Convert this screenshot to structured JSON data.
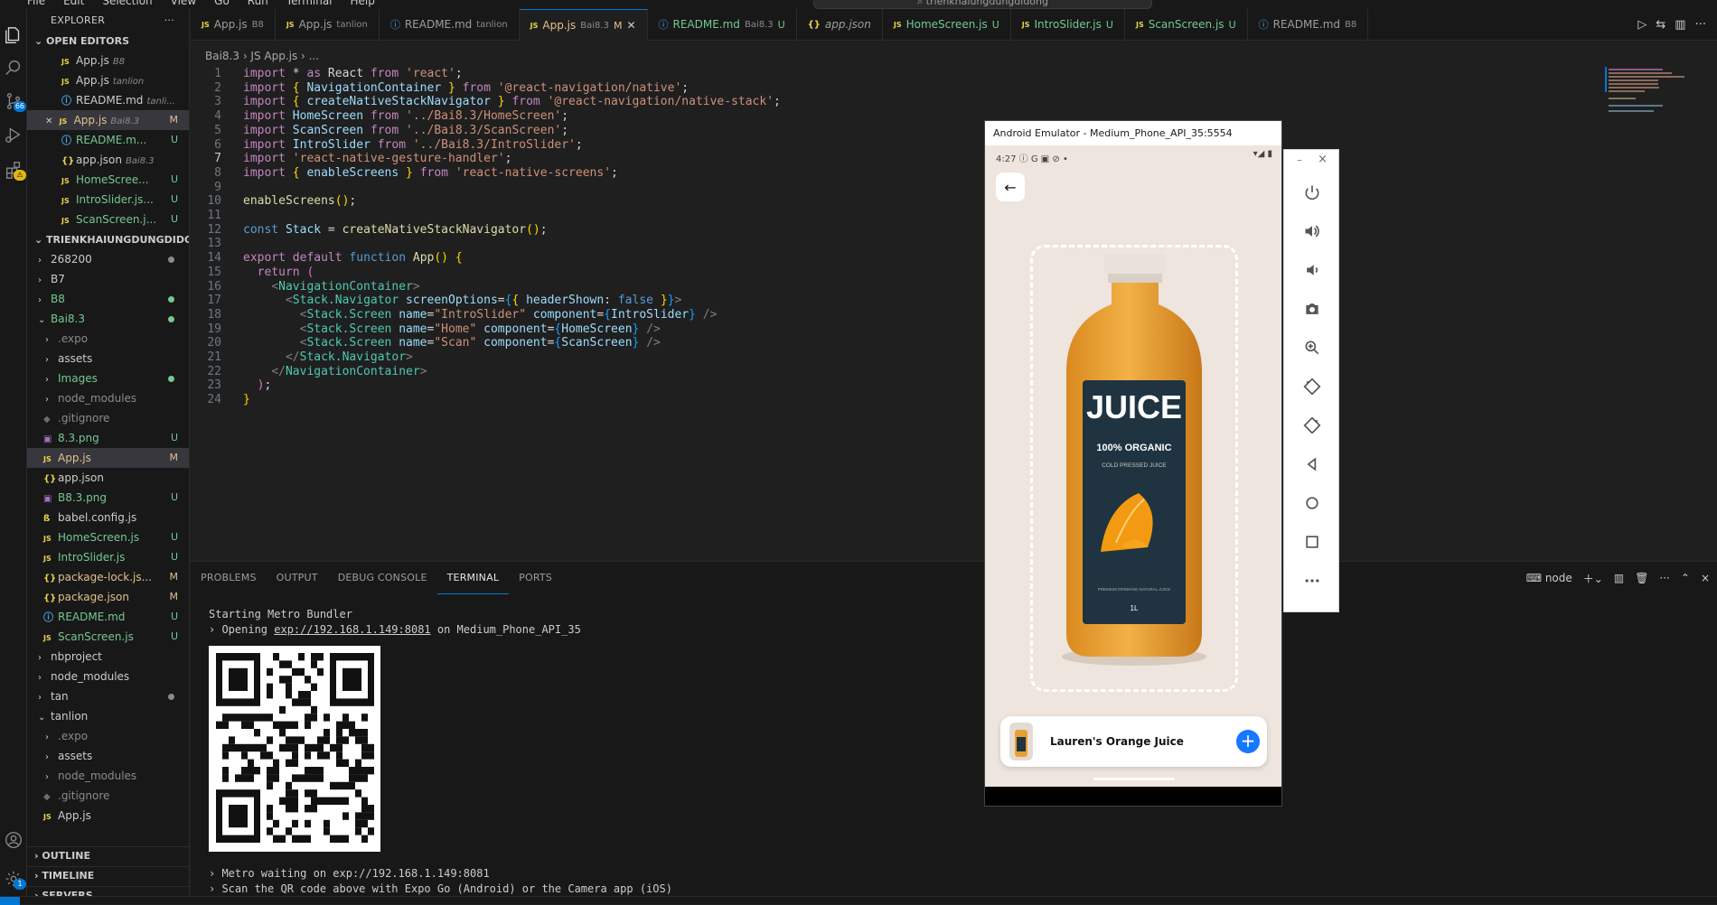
{
  "titlebar": {
    "menu": [
      "File",
      "Edit",
      "Selection",
      "View",
      "Go",
      "Run",
      "Terminal",
      "Help"
    ],
    "search": "trienkhaiungdungdidong"
  },
  "activity": {
    "scm_badge": "66",
    "extensions_badge": "1"
  },
  "explorer": {
    "title": "EXPLORER",
    "more": "···",
    "open_editors_header": "OPEN EDITORS",
    "open_editors": [
      {
        "icon": "JS",
        "name": "App.js",
        "desc": "B8",
        "status": ""
      },
      {
        "icon": "JS",
        "name": "App.js",
        "desc": "tanlion",
        "status": ""
      },
      {
        "icon": "ⓘ",
        "name": "README.md",
        "desc": "tanli...",
        "status": ""
      },
      {
        "icon": "JS",
        "name": "App.js",
        "desc": "Bai8.3",
        "status": "M"
      },
      {
        "icon": "ⓘ",
        "name": "README.m...",
        "desc": "",
        "status": "U"
      },
      {
        "icon": "{}",
        "name": "app.json",
        "desc": "Bai8.3",
        "status": ""
      },
      {
        "icon": "JS",
        "name": "HomeScree...",
        "desc": "",
        "status": "U"
      },
      {
        "icon": "JS",
        "name": "IntroSlider.js...",
        "desc": "",
        "status": "U"
      },
      {
        "icon": "JS",
        "name": "ScanScreen.j...",
        "desc": "",
        "status": "U"
      }
    ],
    "workspace_header": "TRIENKHAIUNGDUNGDIDO...",
    "tree": [
      {
        "chev": "›",
        "name": "268200",
        "indent": 0
      },
      {
        "chev": "›",
        "name": "B7",
        "indent": 0
      },
      {
        "chev": "›",
        "name": "B8",
        "indent": 0
      },
      {
        "chev": "⌄",
        "name": "Bai8.3",
        "indent": 0
      },
      {
        "chev": "›",
        "name": ".expo",
        "indent": 1
      },
      {
        "chev": "›",
        "name": "assets",
        "indent": 1
      },
      {
        "chev": "›",
        "name": "Images",
        "indent": 1
      },
      {
        "chev": "›",
        "name": "node_modules",
        "indent": 1
      },
      {
        "icon": "◆",
        "name": ".gitignore",
        "indent": 1
      },
      {
        "icon": "▣",
        "name": "8.3.png",
        "indent": 1,
        "status": "U"
      },
      {
        "icon": "JS",
        "name": "App.js",
        "indent": 1,
        "status": "M"
      },
      {
        "icon": "{}",
        "name": "app.json",
        "indent": 1
      },
      {
        "icon": "▣",
        "name": "B8.3.png",
        "indent": 1,
        "status": "U"
      },
      {
        "icon": "ß",
        "name": "babel.config.js",
        "indent": 1
      },
      {
        "icon": "JS",
        "name": "HomeScreen.js",
        "indent": 1,
        "status": "U"
      },
      {
        "icon": "JS",
        "name": "IntroSlider.js",
        "indent": 1,
        "status": "U"
      },
      {
        "icon": "{}",
        "name": "package-lock.js...",
        "indent": 1,
        "status": "M"
      },
      {
        "icon": "{}",
        "name": "package.json",
        "indent": 1,
        "status": "M"
      },
      {
        "icon": "ⓘ",
        "name": "README.md",
        "indent": 1,
        "status": "U"
      },
      {
        "icon": "JS",
        "name": "ScanScreen.js",
        "indent": 1,
        "status": "U"
      },
      {
        "chev": "›",
        "name": "nbproject",
        "indent": 0
      },
      {
        "chev": "›",
        "name": "node_modules",
        "indent": 0
      },
      {
        "chev": "›",
        "name": "tan",
        "indent": 0
      },
      {
        "chev": "⌄",
        "name": "tanlion",
        "indent": 0
      },
      {
        "chev": "›",
        "name": ".expo",
        "indent": 1
      },
      {
        "chev": "›",
        "name": "assets",
        "indent": 1
      },
      {
        "chev": "›",
        "name": "node_modules",
        "indent": 1
      },
      {
        "icon": "◆",
        "name": ".gitignore",
        "indent": 1
      },
      {
        "icon": "JS",
        "name": "App.js",
        "indent": 1
      }
    ],
    "outline": "OUTLINE",
    "timeline": "TIMELINE",
    "servers": "SERVERS"
  },
  "tabs": [
    {
      "icon": "JS",
      "name": "App.js",
      "desc": "B8",
      "status": ""
    },
    {
      "icon": "JS",
      "name": "App.js",
      "desc": "tanlion",
      "status": ""
    },
    {
      "icon": "ⓘ",
      "name": "README.md",
      "desc": "tanlion",
      "status": ""
    },
    {
      "icon": "JS",
      "name": "App.js",
      "desc": "Bai8.3",
      "status": "M",
      "active": true
    },
    {
      "icon": "ⓘ",
      "name": "README.md",
      "desc": "Bai8.3",
      "status": "U"
    },
    {
      "icon": "{}",
      "name": "app.json",
      "desc": "",
      "status": ""
    },
    {
      "icon": "JS",
      "name": "HomeScreen.js",
      "desc": "",
      "status": "U"
    },
    {
      "icon": "JS",
      "name": "IntroSlider.js",
      "desc": "",
      "status": "U"
    },
    {
      "icon": "JS",
      "name": "ScanScreen.js",
      "desc": "",
      "status": "U"
    },
    {
      "icon": "ⓘ",
      "name": "README.md",
      "desc": "B8",
      "status": ""
    }
  ],
  "breadcrumb": "Bai8.3  ›  JS App.js  ›  ...",
  "editor": {
    "line_numbers": [
      "1",
      "2",
      "3",
      "4",
      "5",
      "6",
      "7",
      "8",
      "9",
      "10",
      "11",
      "12",
      "13",
      "14",
      "15",
      "16",
      "17",
      "18",
      "19",
      "20",
      "21",
      "22",
      "23",
      "24"
    ],
    "lines": [
      [
        [
          "kw",
          "import"
        ],
        [
          "pl",
          " * "
        ],
        [
          "kw",
          "as"
        ],
        [
          "pl",
          " React "
        ],
        [
          "kw",
          "from"
        ],
        [
          "pl",
          " "
        ],
        [
          "st2",
          "'react'"
        ],
        [
          "pl",
          ";"
        ]
      ],
      [
        [
          "kw",
          "import"
        ],
        [
          "pl",
          " "
        ],
        [
          "brk1",
          "{"
        ],
        [
          "pl",
          " "
        ],
        [
          "var",
          "NavigationContainer"
        ],
        [
          "pl",
          " "
        ],
        [
          "brk1",
          "}"
        ],
        [
          "pl",
          " "
        ],
        [
          "kw",
          "from"
        ],
        [
          "pl",
          " "
        ],
        [
          "st2",
          "'@react-navigation/native'"
        ],
        [
          "pl",
          ";"
        ]
      ],
      [
        [
          "kw",
          "import"
        ],
        [
          "pl",
          " "
        ],
        [
          "brk1",
          "{"
        ],
        [
          "pl",
          " "
        ],
        [
          "var",
          "createNativeStackNavigator"
        ],
        [
          "pl",
          " "
        ],
        [
          "brk1",
          "}"
        ],
        [
          "pl",
          " "
        ],
        [
          "kw",
          "from"
        ],
        [
          "pl",
          " "
        ],
        [
          "st2",
          "'@react-navigation/native-stack'"
        ],
        [
          "pl",
          ";"
        ]
      ],
      [
        [
          "kw",
          "import"
        ],
        [
          "pl",
          " "
        ],
        [
          "var",
          "HomeScreen"
        ],
        [
          "pl",
          " "
        ],
        [
          "kw",
          "from"
        ],
        [
          "pl",
          " "
        ],
        [
          "st2",
          "'../Bai8.3/HomeScreen'"
        ],
        [
          "pl",
          ";"
        ]
      ],
      [
        [
          "kw",
          "import"
        ],
        [
          "pl",
          " "
        ],
        [
          "var",
          "ScanScreen"
        ],
        [
          "pl",
          " "
        ],
        [
          "kw",
          "from"
        ],
        [
          "pl",
          " "
        ],
        [
          "st2",
          "'../Bai8.3/ScanScreen'"
        ],
        [
          "pl",
          ";"
        ]
      ],
      [
        [
          "kw",
          "import"
        ],
        [
          "pl",
          " "
        ],
        [
          "var",
          "IntroSlider"
        ],
        [
          "pl",
          " "
        ],
        [
          "kw",
          "from"
        ],
        [
          "pl",
          " "
        ],
        [
          "st2",
          "'../Bai8.3/IntroSlider'"
        ],
        [
          "pl",
          ";"
        ]
      ],
      [
        [
          "kw",
          "import"
        ],
        [
          "pl",
          " "
        ],
        [
          "st2",
          "'react-native-gesture-handler'"
        ],
        [
          "pl",
          ";"
        ]
      ],
      [
        [
          "kw",
          "import"
        ],
        [
          "pl",
          " "
        ],
        [
          "brk1",
          "{"
        ],
        [
          "pl",
          " "
        ],
        [
          "var",
          "enableScreens"
        ],
        [
          "pl",
          " "
        ],
        [
          "brk1",
          "}"
        ],
        [
          "pl",
          " "
        ],
        [
          "kw",
          "from"
        ],
        [
          "pl",
          " "
        ],
        [
          "st2",
          "'react-native-screens'"
        ],
        [
          "pl",
          ";"
        ]
      ],
      [],
      [
        [
          "fn",
          "enableScreens"
        ],
        [
          "brk1",
          "()"
        ],
        [
          "pl",
          ";"
        ]
      ],
      [],
      [
        [
          "kb",
          "const"
        ],
        [
          "pl",
          " "
        ],
        [
          "var",
          "Stack"
        ],
        [
          "pl",
          " = "
        ],
        [
          "fn",
          "createNativeStackNavigator"
        ],
        [
          "brk1",
          "()"
        ],
        [
          "pl",
          ";"
        ]
      ],
      [],
      [
        [
          "kw",
          "export"
        ],
        [
          "pl",
          " "
        ],
        [
          "kw",
          "default"
        ],
        [
          "pl",
          " "
        ],
        [
          "kb",
          "function"
        ],
        [
          "pl",
          " "
        ],
        [
          "fn",
          "App"
        ],
        [
          "brk1",
          "()"
        ],
        [
          "pl",
          " "
        ],
        [
          "brk1",
          "{"
        ]
      ],
      [
        [
          "pl",
          "  "
        ],
        [
          "kw",
          "return"
        ],
        [
          "pl",
          " "
        ],
        [
          "brk2",
          "("
        ]
      ],
      [
        [
          "pl",
          "    "
        ],
        [
          "tg",
          "<"
        ],
        [
          "cls",
          "NavigationContainer"
        ],
        [
          "tg",
          ">"
        ]
      ],
      [
        [
          "pl",
          "      "
        ],
        [
          "tg",
          "<"
        ],
        [
          "cls",
          "Stack.Navigator"
        ],
        [
          "pl",
          " "
        ],
        [
          "var",
          "screenOptions"
        ],
        [
          "pl",
          "="
        ],
        [
          "brk3",
          "{"
        ],
        [
          "brk1",
          "{"
        ],
        [
          "pl",
          " "
        ],
        [
          "var",
          "headerShown"
        ],
        [
          "pl",
          ": "
        ],
        [
          "kb",
          "false"
        ],
        [
          "pl",
          " "
        ],
        [
          "brk1",
          "}"
        ],
        [
          "brk3",
          "}"
        ],
        [
          "tg",
          ">"
        ]
      ],
      [
        [
          "pl",
          "        "
        ],
        [
          "tg",
          "<"
        ],
        [
          "cls",
          "Stack.Screen"
        ],
        [
          "pl",
          " "
        ],
        [
          "var",
          "name"
        ],
        [
          "pl",
          "="
        ],
        [
          "st2",
          "\"IntroSlider\""
        ],
        [
          "pl",
          " "
        ],
        [
          "var",
          "component"
        ],
        [
          "pl",
          "="
        ],
        [
          "brk3",
          "{"
        ],
        [
          "var",
          "IntroSlider"
        ],
        [
          "brk3",
          "}"
        ],
        [
          "pl",
          " "
        ],
        [
          "tg",
          "/>"
        ]
      ],
      [
        [
          "pl",
          "        "
        ],
        [
          "tg",
          "<"
        ],
        [
          "cls",
          "Stack.Screen"
        ],
        [
          "pl",
          " "
        ],
        [
          "var",
          "name"
        ],
        [
          "pl",
          "="
        ],
        [
          "st2",
          "\"Home\""
        ],
        [
          "pl",
          " "
        ],
        [
          "var",
          "component"
        ],
        [
          "pl",
          "="
        ],
        [
          "brk3",
          "{"
        ],
        [
          "var",
          "HomeScreen"
        ],
        [
          "brk3",
          "}"
        ],
        [
          "pl",
          " "
        ],
        [
          "tg",
          "/>"
        ]
      ],
      [
        [
          "pl",
          "        "
        ],
        [
          "tg",
          "<"
        ],
        [
          "cls",
          "Stack.Screen"
        ],
        [
          "pl",
          " "
        ],
        [
          "var",
          "name"
        ],
        [
          "pl",
          "="
        ],
        [
          "st2",
          "\"Scan\""
        ],
        [
          "pl",
          " "
        ],
        [
          "var",
          "component"
        ],
        [
          "pl",
          "="
        ],
        [
          "brk3",
          "{"
        ],
        [
          "var",
          "ScanScreen"
        ],
        [
          "brk3",
          "}"
        ],
        [
          "pl",
          " "
        ],
        [
          "tg",
          "/>"
        ]
      ],
      [
        [
          "pl",
          "      "
        ],
        [
          "tg",
          "</"
        ],
        [
          "cls",
          "Stack.Navigator"
        ],
        [
          "tg",
          ">"
        ]
      ],
      [
        [
          "pl",
          "    "
        ],
        [
          "tg",
          "</"
        ],
        [
          "cls",
          "NavigationContainer"
        ],
        [
          "tg",
          ">"
        ]
      ],
      [
        [
          "pl",
          "  "
        ],
        [
          "brk2",
          ")"
        ],
        [
          "pl",
          ";"
        ]
      ],
      [
        [
          "brk1",
          "}"
        ]
      ]
    ]
  },
  "panel": {
    "tabs": [
      "PROBLEMS",
      "OUTPUT",
      "DEBUG CONSOLE",
      "TERMINAL",
      "PORTS"
    ],
    "active_tab": "TERMINAL",
    "shell": "node",
    "terminal_lines": [
      {
        "pre": "Starting Metro Bundler",
        "url": "",
        "post": ""
      },
      {
        "pre": "› Opening ",
        "url": "exp://192.168.1.149:8081",
        "post": " on Medium_Phone_API_35"
      }
    ],
    "terminal_lines_2": [
      {
        "pre": "› Metro waiting on ",
        "url": "exp://192.168.1.149:8081",
        "post": ""
      },
      {
        "pre": "› Scan the QR code above with Expo Go (Android) or the Camera app (iOS)",
        "url": "",
        "post": ""
      }
    ]
  },
  "emulator": {
    "title": "Android Emulator - Medium_Phone_API_35:5554",
    "status_time": "4:27",
    "status_icons": "ⓘ G ▣ ⊘ •",
    "status_right": "▾◢ ▮",
    "bottle_title": "JUICE",
    "bottle_sub1": "100% ORGANIC",
    "bottle_sub2": "COLD PRESSED JUICE",
    "bottle_fine": "PREMIUM DRINKING NATURAL JUICE",
    "bottle_volume": "1L",
    "product_name": "Lauren's Orange Juice",
    "add": "+"
  },
  "emu_controls": {
    "minimize": "–",
    "close": "×"
  }
}
